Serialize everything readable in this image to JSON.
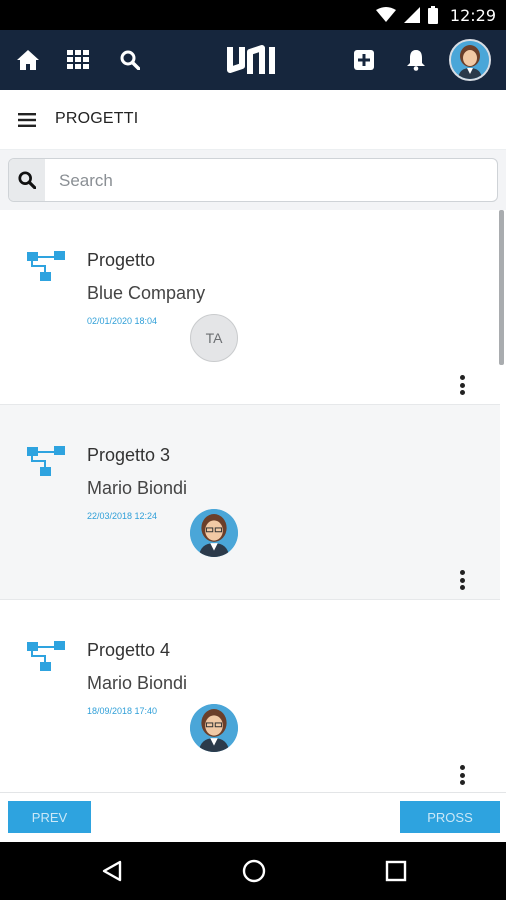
{
  "status_bar": {
    "time": "12:29"
  },
  "app_bar": {
    "logo_text": "uni",
    "icons": [
      "home-icon",
      "apps-grid-icon",
      "search-icon",
      "add-box-icon",
      "bell-icon"
    ]
  },
  "header": {
    "title": "PROGETTI",
    "menu_icon": "hamburger-menu-icon"
  },
  "search": {
    "placeholder": "Search",
    "value": ""
  },
  "projects": [
    {
      "name": "Progetto",
      "company": "Blue Company",
      "date": "02/01/2020 18:04",
      "member_initials": "TA",
      "member_type": "initials"
    },
    {
      "name": "Progetto 3",
      "company": "Mario Biondi",
      "date": "22/03/2018 12:24",
      "member_initials": "",
      "member_type": "photo"
    },
    {
      "name": "Progetto 4",
      "company": "Mario Biondi",
      "date": "18/09/2018 17:40",
      "member_initials": "",
      "member_type": "photo"
    }
  ],
  "pager": {
    "prev_label": "PREV",
    "next_label": "PROSS"
  },
  "colors": {
    "app_bar": "#16263d",
    "accent": "#2ea3df",
    "date": "#2f9fd8"
  }
}
